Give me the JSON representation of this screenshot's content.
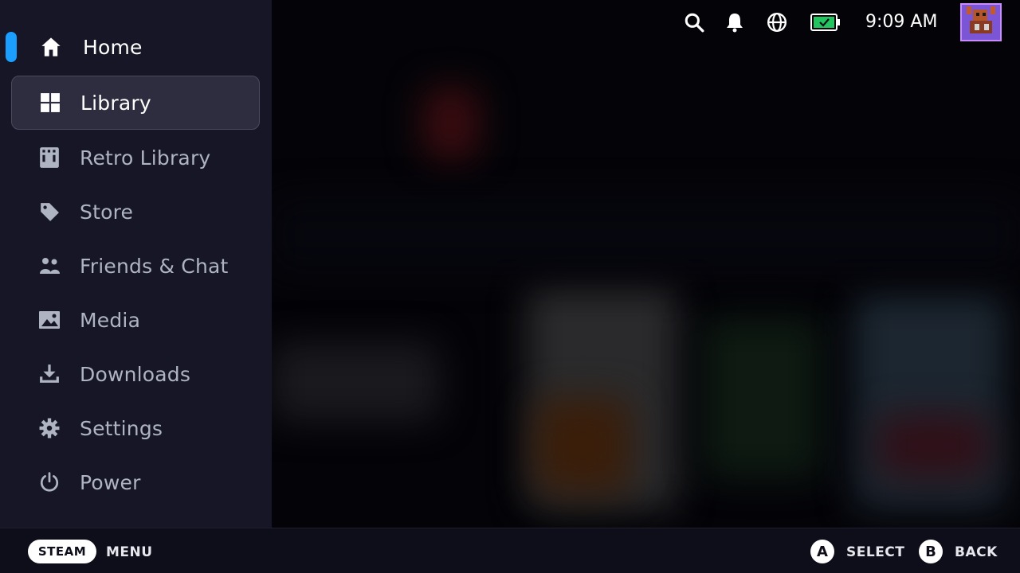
{
  "nav": {
    "items": [
      {
        "label": "Home",
        "icon": "home-icon"
      },
      {
        "label": "Library",
        "icon": "library-grid-icon"
      },
      {
        "label": "Retro Library",
        "icon": "retro-library-icon"
      },
      {
        "label": "Store",
        "icon": "tag-icon"
      },
      {
        "label": "Friends & Chat",
        "icon": "friends-icon"
      },
      {
        "label": "Media",
        "icon": "image-icon"
      },
      {
        "label": "Downloads",
        "icon": "download-icon"
      },
      {
        "label": "Settings",
        "icon": "gear-icon"
      },
      {
        "label": "Power",
        "icon": "power-icon"
      }
    ],
    "selected": "Library",
    "active_indicator": "Home"
  },
  "topbar": {
    "time": "9:09 AM",
    "icons": [
      "search-icon",
      "bell-icon",
      "globe-icon",
      "battery-icon"
    ],
    "battery_color": "#22c55e"
  },
  "footer": {
    "steam_label": "STEAM",
    "menu_label": "MENU",
    "a_button": "A",
    "select_label": "SELECT",
    "b_button": "B",
    "back_label": "BACK"
  },
  "colors": {
    "accent": "#1a9fff",
    "sidebar_bg": "#161626",
    "selected_bg": "#2d2d3f"
  }
}
